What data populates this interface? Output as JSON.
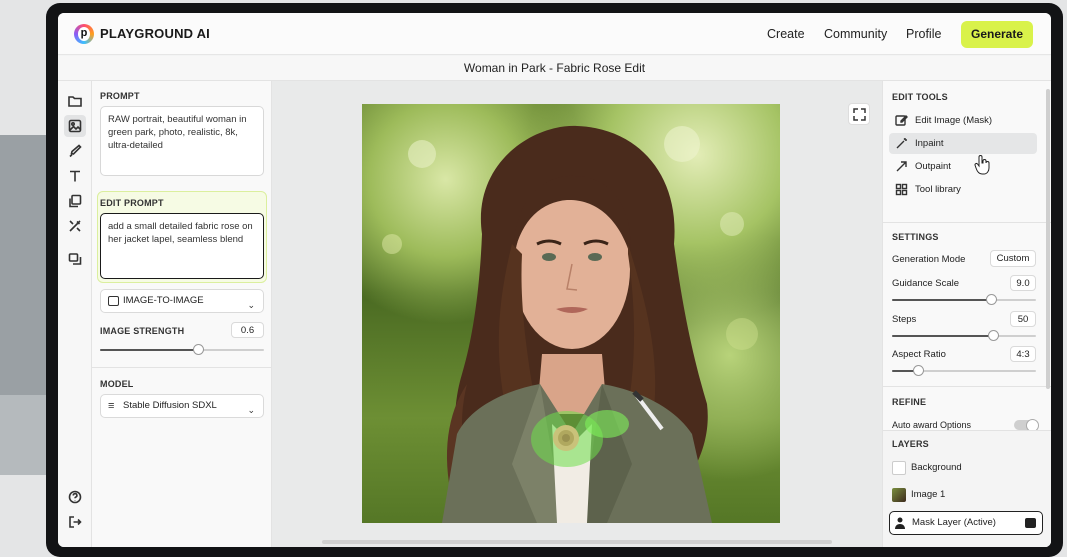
{
  "app": {
    "brand": "PLAYGROUND AI",
    "nav": [
      "Create",
      "Community",
      "Profile"
    ],
    "generate_label": "Generate",
    "doc_title": "Woman in Park - Fabric Rose Edit"
  },
  "icons": [
    "folder-icon",
    "image-select-icon",
    "brush-icon",
    "text-icon",
    "copy-icon",
    "tools-icon",
    "compare-icon",
    "help-icon",
    "logout-icon"
  ],
  "left": {
    "prompt_label": "PROMPT",
    "prompt_text": "RAW portrait, beautiful woman in green park, photo, realistic, 8k, ultra-detailed",
    "edit_prompt_label": "EDIT PROMPT",
    "edit_prompt_text": "add a small detailed fabric rose on her jacket lapel, seamless blend",
    "mode": "IMAGE-TO-IMAGE",
    "strength_label": "IMAGE STRENGTH",
    "strength_value": "0.6",
    "model_label": "MODEL",
    "model_value": "Stable Diffusion SDXL"
  },
  "right": {
    "edit_tools_label": "EDIT TOOLS",
    "tools": [
      "Edit Image (Mask)",
      "Inpaint",
      "Outpaint",
      "Tool library"
    ],
    "settings_label": "SETTINGS",
    "gen_mode_label": "Generation Mode",
    "gen_mode_value": "Custom",
    "guidance_label": "Guidance Scale",
    "guidance_value": "9.0",
    "steps_label": "Steps",
    "steps_value": "50",
    "aspect_label": "Aspect Ratio",
    "aspect_value": "4:3",
    "refine_label": "REFINE",
    "refine_option": "Auto award Options",
    "layers_label": "LAYERS",
    "layers": [
      "Background",
      "Image 1",
      "Mask Layer (Active)"
    ]
  },
  "colors": {
    "accent": "#d9f24a",
    "mask": "#6ee04a"
  }
}
